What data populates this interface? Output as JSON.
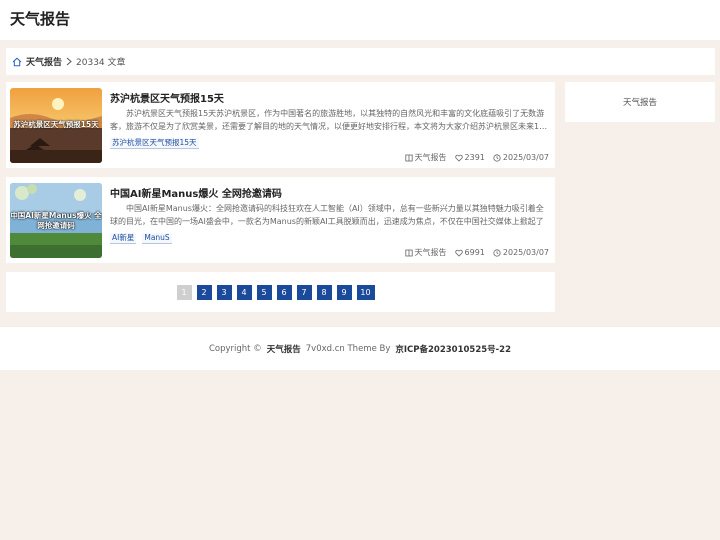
{
  "header": {
    "site_title": "天气报告"
  },
  "breadcrumb": {
    "home": "天气报告",
    "count": "20334 文章"
  },
  "posts": [
    {
      "thumb_text": "苏沪杭景区天气预报15天",
      "title": "苏沪杭景区天气预报15天",
      "excerpt": "苏沪杭景区天气预报15天苏沪杭景区，作为中国著名的旅游胜地，以其独特的自然风光和丰富的文化底蕴吸引了无数游客，旅游不仅是为了欣赏美景，还需要了解目的地的天气情况，以便更好地安排行程，本文将为大家介绍苏沪杭景区未来1…",
      "tags": [
        "苏沪杭景区天气预报15天"
      ],
      "category": "天气报告",
      "likes": "2391",
      "date": "2025/03/07"
    },
    {
      "thumb_text": "中国AI新星Manus爆火 全网抢邀请码",
      "title": "中国AI新星Manus爆火 全网抢邀请码",
      "excerpt": "中国AI新星Manus爆火：全网抢邀请码的科技狂欢在人工智能（AI）领域中，总有一些新兴力量以其独特魅力吸引着全球的目光，在中国的一场AI盛会中，一款名为Manus的新颖AI工具脱颖而出，迅速成为焦点，不仅在中国社交媒体上掀起了一…",
      "tags": [
        "AI新星",
        "ManuS"
      ],
      "category": "天气报告",
      "likes": "6991",
      "date": "2025/03/07"
    }
  ],
  "pagination": {
    "pages": [
      "1",
      "2",
      "3",
      "4",
      "5",
      "6",
      "7",
      "8",
      "9",
      "10"
    ],
    "current": "1"
  },
  "sidebar": {
    "title": "天气报告"
  },
  "footer": {
    "copyright": "Copyright ©",
    "site": "天气报告",
    "theme": "7v0xd.cn Theme By",
    "icp": "京ICP备2023010525号-22"
  },
  "colors": {
    "accent": "#1c4a9b",
    "background": "#f7efe9",
    "tag": "#1e4fa1"
  }
}
